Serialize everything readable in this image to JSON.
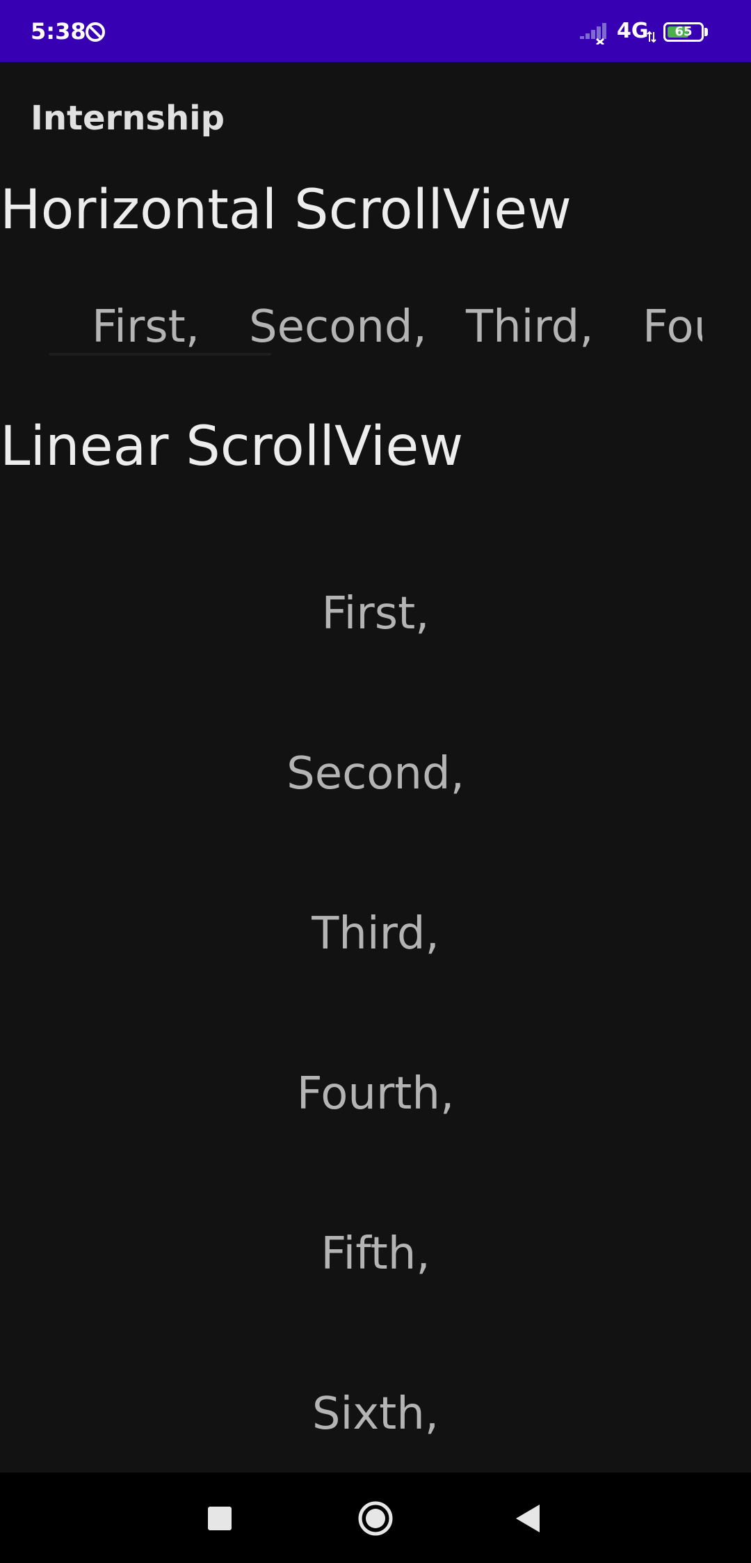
{
  "status_bar": {
    "time": "5:38",
    "network": "4G",
    "battery_level": "65",
    "battery_percent": 65,
    "left_icon": "do-not-disturb-icon",
    "signal_icon": "signal-no-service-icon",
    "colors": {
      "background": "#3700B3",
      "battery_fill": "#4CAF50"
    }
  },
  "app_bar": {
    "title": "Internship"
  },
  "horizontal_section": {
    "heading": "Horizontal ScrollView",
    "items": [
      "First,",
      "Second,",
      "Third,",
      "Fou"
    ]
  },
  "linear_section": {
    "heading": "Linear ScrollView",
    "items": [
      "First,",
      "Second,",
      "Third,",
      "Fourth,",
      "Fifth,",
      "Sixth,"
    ]
  },
  "nav_bar": {
    "icons": [
      "recents-square-icon",
      "home-circle-icon",
      "back-triangle-icon"
    ]
  },
  "theme": {
    "background": "#121212",
    "text_primary": "#EDEDED",
    "text_secondary": "#B4B4B4"
  }
}
